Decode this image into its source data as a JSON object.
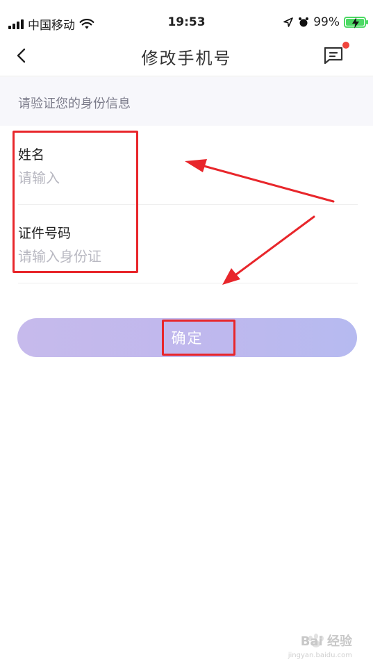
{
  "status_bar": {
    "carrier": "中国移动",
    "time": "19:53",
    "battery_percent": "99%",
    "battery_level": 0.99,
    "battery_color": "#4cd964"
  },
  "nav": {
    "title": "修改手机号",
    "back_icon": "chevron-left-icon",
    "message_icon": "message-icon",
    "badge_color": "#f0443c"
  },
  "section": {
    "header": "请验证您的身份信息"
  },
  "form": {
    "name_label": "姓名",
    "name_placeholder": "请输入",
    "name_value": "",
    "id_label": "证件号码",
    "id_placeholder": "请输入身份证",
    "id_value": ""
  },
  "confirm": {
    "label": "确定",
    "gradient_start": "#c6baec",
    "gradient_end": "#b6baf0"
  },
  "annotation": {
    "color": "#e8262b"
  },
  "watermark": {
    "brand": "Bai 经验",
    "url": "jingyan.baidu.com"
  }
}
